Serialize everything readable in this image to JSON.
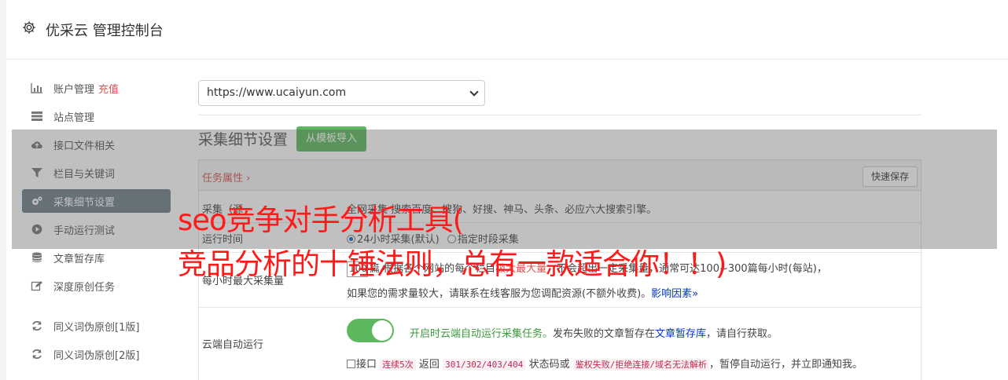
{
  "header": {
    "title": "优采云 管理控制台",
    "icon": "gear-icon"
  },
  "sidebar": {
    "items": [
      {
        "label": "账户管理",
        "extra": "充值",
        "icon": "bar-chart-icon"
      },
      {
        "label": "站点管理",
        "icon": "server-icon"
      },
      {
        "label": "接口文件相关",
        "icon": "cloud-upload-icon"
      },
      {
        "label": "栏目与关键词",
        "icon": "filter-icon"
      },
      {
        "label": "采集细节设置",
        "icon": "gears-icon",
        "active": true
      },
      {
        "label": "手动运行测试",
        "icon": "play-circle-icon"
      },
      {
        "label": "文章暂存库",
        "icon": "database-icon"
      },
      {
        "label": "深度原创任务",
        "icon": "edit-icon"
      },
      {
        "label": "同义词伪原创[1版]",
        "icon": "refresh-icon"
      },
      {
        "label": "同义词伪原创[2版]",
        "icon": "refresh-icon"
      }
    ]
  },
  "main": {
    "site_select": {
      "value": "https://www.ucaiyun.com"
    },
    "section_title": "采集细节设置",
    "import_button": "从模板导入",
    "panel": {
      "tab_label": "任务属性 ›",
      "save_button": "快速保存",
      "row1": {
        "label": "采集（源",
        "text": "全网采集  搜索百度、搜狗、好搜、神马、头条、必应六大搜索引擎。"
      },
      "row2": {
        "label": "运行时间",
        "opt1": "24小时采集(默认)",
        "opt2": "指定时段采集"
      },
      "row3": {
        "label": "每小时最大采集量",
        "num": "100",
        "line1_a": "篇 根据各个网站的每个栏目",
        "line1_red": "极大最大量",
        "line1_b": "，不会超出一定采集量，通常可达100~300篇每小时(每站)，",
        "line2": "如果您的需求量较大，请联系在线客服为您调配资源(不额外收费)。",
        "line2_link": "影响因素",
        "line2_link_chev": "»"
      },
      "row4": {
        "label": "云端自动运行",
        "enable_text": "开启时云端自动运行采集任务。",
        "desc_a": "发布失败的文章暂存在",
        "desc_link": "文章暂存库",
        "desc_b": "，请自行获取。",
        "cb_label": "接口",
        "code1": "连续5次",
        "mid1": "返回",
        "code2": "301/302/403/404",
        "mid2": "状态码或",
        "code3": "鉴权失败/拒绝连接/域名无法解析",
        "tail": "，暂停自动运行，并立即通知我。"
      }
    }
  },
  "overlay": {
    "line1": "seo竞争对手分析工具(",
    "line2": "竞品分析的十锤法则，总有一款适合你！！)"
  },
  "colors": {
    "accent_green": "#5cb85c",
    "accent_red": "#d9534f",
    "sidebar_active": "#6d7e8a",
    "overlay_text": "#ff1a1a"
  }
}
